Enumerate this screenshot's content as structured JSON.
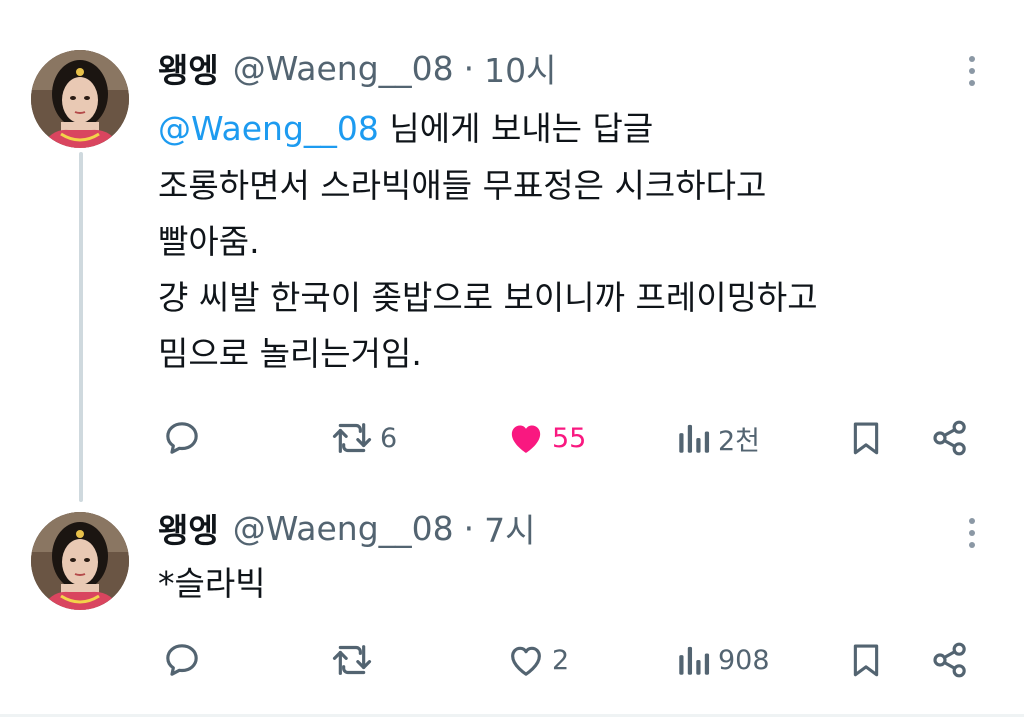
{
  "tweets": [
    {
      "name": "왱엥",
      "handle": "@Waeng__08",
      "dot": "·",
      "time": "10시",
      "reply_mention": "@Waeng__08",
      "reply_suffix": " 님에게 보내는 답글",
      "lines": [
        "조롱하면서 스라빅애들 무표정은 시크하다고",
        "빨아줌.",
        "걍 씨발 한국이 좆밥으로 보이니까 프레이밍하고",
        "밈으로 놀리는거임."
      ],
      "stats": {
        "replies": "",
        "retweets": "6",
        "likes": "55",
        "views": "2천"
      },
      "liked": true
    },
    {
      "name": "왱엥",
      "handle": "@Waeng__08",
      "dot": "·",
      "time": "7시",
      "lines": [
        "*슬라빅"
      ],
      "stats": {
        "replies": "",
        "retweets": "",
        "likes": "2",
        "views": "908"
      },
      "liked": false
    }
  ],
  "icons": {
    "reply": "speech-bubble-icon",
    "retweet": "retweet-icon",
    "like": "heart-icon",
    "views": "bar-chart-icon",
    "bookmark": "bookmark-icon",
    "share": "share-icon",
    "more": "more-dots-icon"
  },
  "colors": {
    "accent": "#1d9bf0",
    "like": "#f91880",
    "muted": "#536471",
    "text": "#0f1419",
    "thread_line": "#cfd9de"
  }
}
